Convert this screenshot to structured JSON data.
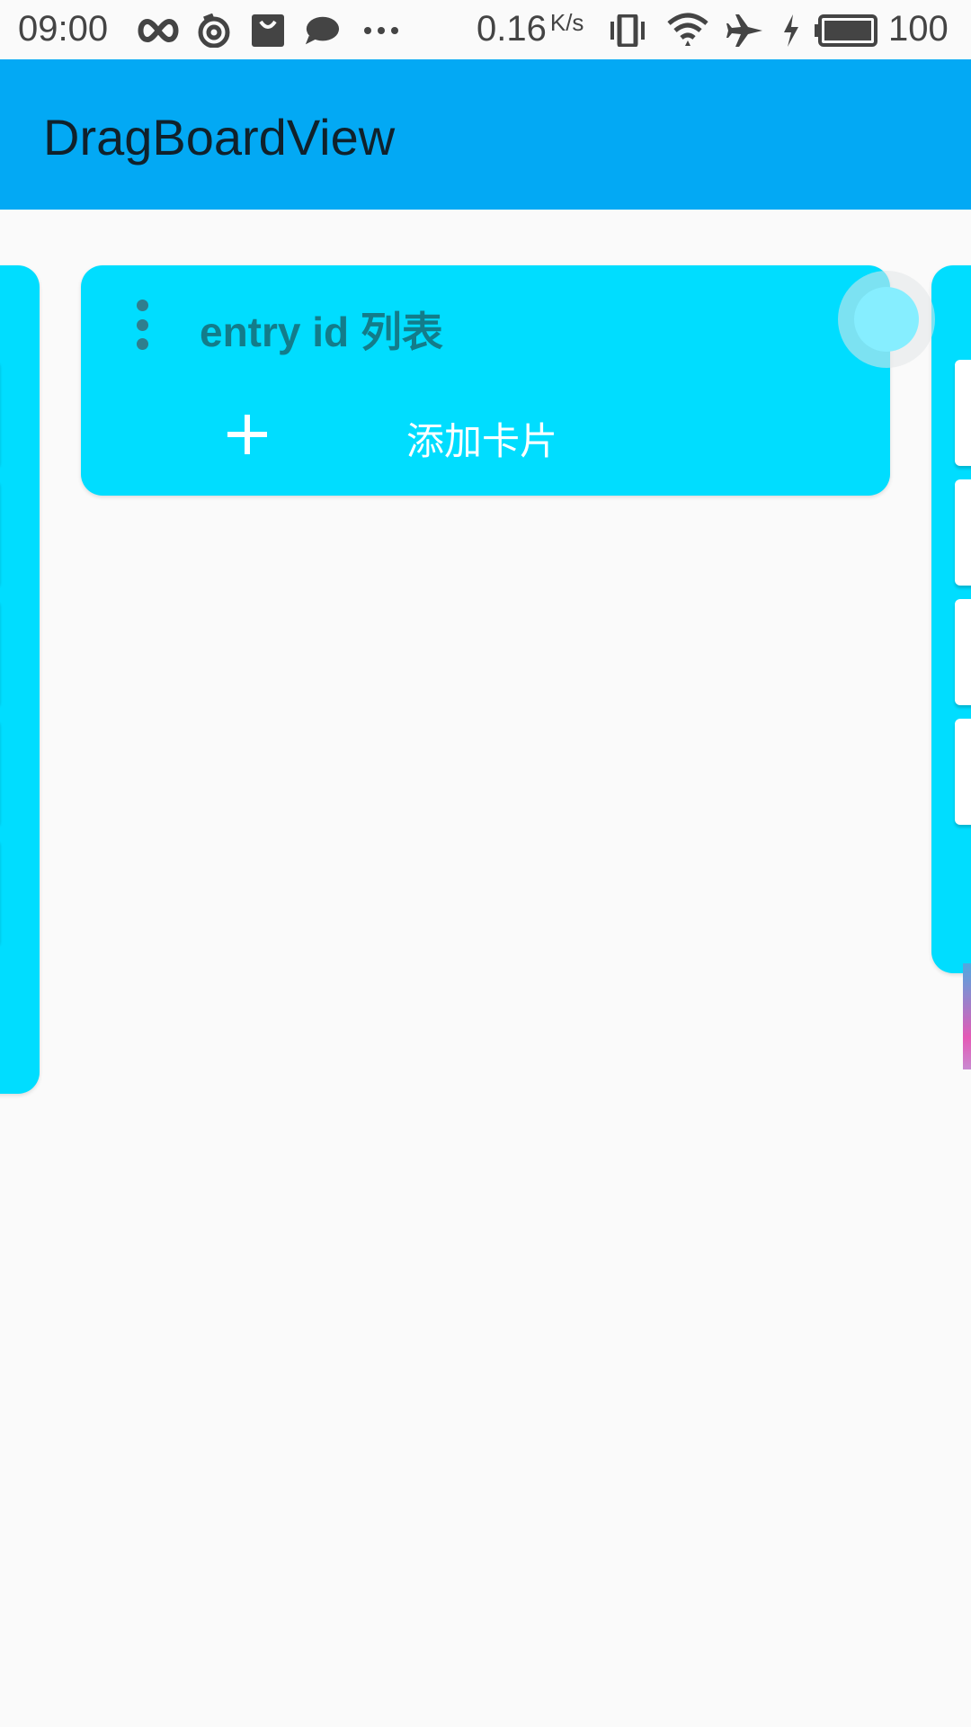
{
  "status_bar": {
    "time": "09:00",
    "network_speed": "0.16",
    "network_speed_unit": "K/s",
    "battery_level": "100",
    "icons": [
      "infinity-icon",
      "swirl-icon",
      "bag-icon",
      "chat-bubble-icon",
      "more-icon",
      "vibrate-icon",
      "wifi-icon",
      "airplane-icon",
      "charging-icon",
      "battery-icon"
    ]
  },
  "app_bar": {
    "title": "DragBoardView",
    "color": "#03A9F4"
  },
  "board": {
    "column_color": "#00DDFF",
    "columns": [
      {
        "title": "entry id 列表",
        "add_card_label": "添加卡片",
        "menu_icon": "more-vert-icon",
        "add_icon": "plus-icon"
      }
    ]
  }
}
